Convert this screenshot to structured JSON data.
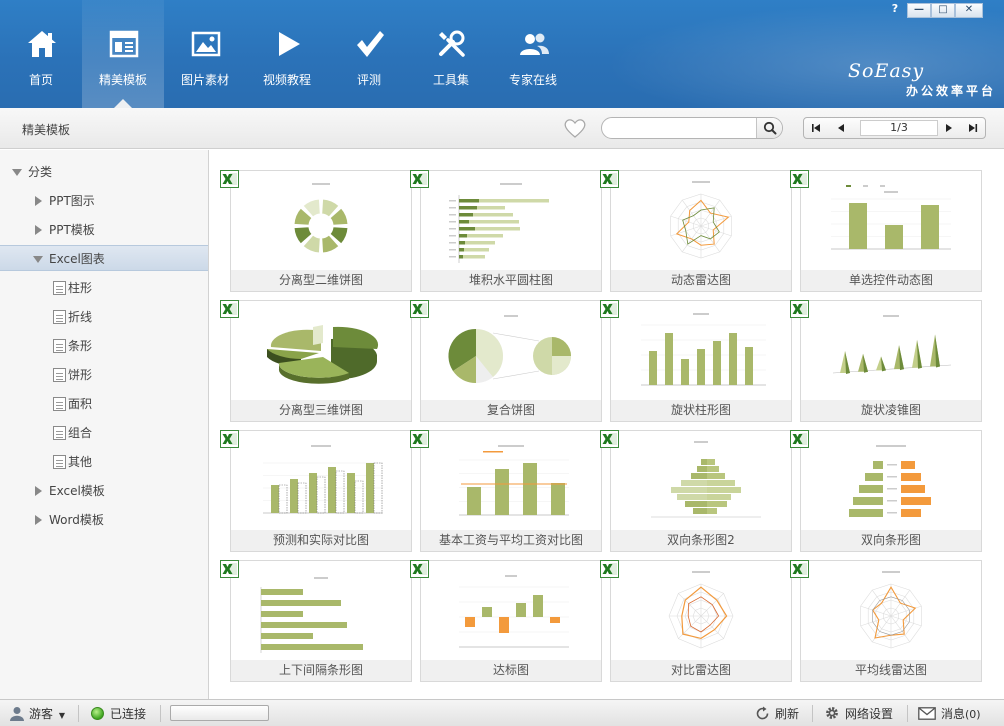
{
  "window": {
    "help": "?",
    "minimize": "—",
    "maximize": "□",
    "close": "✕"
  },
  "nav": {
    "items": [
      {
        "label": "首页",
        "icon": "home-icon"
      },
      {
        "label": "精美模板",
        "icon": "template-icon",
        "active": true
      },
      {
        "label": "图片素材",
        "icon": "picture-icon"
      },
      {
        "label": "视频教程",
        "icon": "play-icon"
      },
      {
        "label": "评测",
        "icon": "check-icon"
      },
      {
        "label": "工具集",
        "icon": "tools-icon"
      },
      {
        "label": "专家在线",
        "icon": "experts-icon"
      }
    ]
  },
  "brand": {
    "en": "SoEasy",
    "cn": "办公效率平台"
  },
  "toolbar": {
    "breadcrumb": "精美模板",
    "search_value": "",
    "page_indicator": "1/3"
  },
  "sidebar": {
    "root": "分类",
    "items": [
      {
        "label": "PPT图示",
        "level": 1,
        "state": "collapsed"
      },
      {
        "label": "PPT模板",
        "level": 1,
        "state": "collapsed"
      },
      {
        "label": "Excel图表",
        "level": 1,
        "state": "expanded",
        "selected": true
      },
      {
        "label": "柱形",
        "level": 2
      },
      {
        "label": "折线",
        "level": 2
      },
      {
        "label": "条形",
        "level": 2
      },
      {
        "label": "饼形",
        "level": 2
      },
      {
        "label": "面积",
        "level": 2
      },
      {
        "label": "组合",
        "level": 2
      },
      {
        "label": "其他",
        "level": 2
      },
      {
        "label": "Excel模板",
        "level": 1,
        "state": "collapsed"
      },
      {
        "label": "Word模板",
        "level": 1,
        "state": "collapsed"
      }
    ]
  },
  "templates": [
    {
      "title": "分离型二维饼图",
      "thumb": "donut"
    },
    {
      "title": "堆积水平圆柱图",
      "thumb": "hbar"
    },
    {
      "title": "动态雷达图",
      "thumb": "radar"
    },
    {
      "title": "单选控件动态图",
      "thumb": "bars3"
    },
    {
      "title": "分离型三维饼图",
      "thumb": "pie3d"
    },
    {
      "title": "复合饼图",
      "thumb": "pieofpie"
    },
    {
      "title": "旋状柱形图",
      "thumb": "columns"
    },
    {
      "title": "旋状凌锥图",
      "thumb": "cones"
    },
    {
      "title": "预测和实际对比图",
      "thumb": "forecast"
    },
    {
      "title": "基本工资与平均工资对比图",
      "thumb": "salary"
    },
    {
      "title": "双向条形图2",
      "thumb": "pyramid"
    },
    {
      "title": "双向条形图",
      "thumb": "twoway"
    },
    {
      "title": "上下间隔条形图",
      "thumb": "gapbars"
    },
    {
      "title": "达标图",
      "thumb": "target"
    },
    {
      "title": "对比雷达图",
      "thumb": "radar2"
    },
    {
      "title": "平均线雷达图",
      "thumb": "radar3"
    }
  ],
  "status": {
    "user": "游客",
    "connection": "已连接",
    "refresh": "刷新",
    "network": "网络设置",
    "messages": "消息",
    "message_count": "(0)"
  },
  "colors": {
    "header": "#2b72b8",
    "chart_green": "#a9b86a",
    "chart_dark_green": "#6d8b3a",
    "chart_orange": "#f39a3c"
  }
}
